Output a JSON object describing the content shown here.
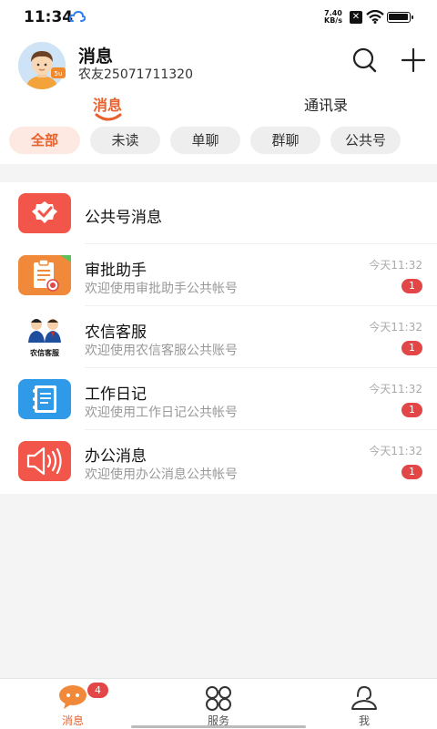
{
  "status_bar": {
    "time": "11:34",
    "net_speed_value": "7.40",
    "net_speed_unit": "KB/s"
  },
  "header": {
    "title": "消息",
    "subtitle": "农友25071711320",
    "avatar_icon": "user-avatar-icon",
    "search_icon": "search-icon",
    "add_icon": "plus-icon"
  },
  "tabs": [
    {
      "label": "消息",
      "active": true
    },
    {
      "label": "通讯录",
      "active": false
    }
  ],
  "filters": [
    {
      "label": "全部",
      "active": true
    },
    {
      "label": "未读",
      "active": false
    },
    {
      "label": "单聊",
      "active": false
    },
    {
      "label": "群聊",
      "active": false
    },
    {
      "label": "公共号",
      "active": false
    }
  ],
  "list": [
    {
      "name": "公共号消息",
      "subtitle": "",
      "time": "",
      "badge": "",
      "icon": "official-account-icon",
      "color": "#f2564a"
    },
    {
      "name": "审批助手",
      "subtitle": "欢迎使用审批助手公共帐号",
      "time": "今天11:32",
      "badge": "1",
      "icon": "approval-clipboard-icon",
      "color": "#f08a3a"
    },
    {
      "name": "农信客服",
      "subtitle": "欢迎使用农信客服公共账号",
      "time": "今天11:32",
      "badge": "1",
      "icon": "customer-service-icon",
      "icon_label": "农信客服",
      "color": "#ffffff"
    },
    {
      "name": "工作日记",
      "subtitle": "欢迎使用工作日记公共帐号",
      "time": "今天11:32",
      "badge": "1",
      "icon": "notebook-icon",
      "color": "#2f9ae8"
    },
    {
      "name": "办公消息",
      "subtitle": "欢迎使用办公消息公共帐号",
      "time": "今天11:32",
      "badge": "1",
      "icon": "speaker-icon",
      "color": "#f2564a"
    }
  ],
  "bottom_nav": [
    {
      "label": "消息",
      "active": true,
      "badge": "4",
      "icon": "chat-bubble-icon"
    },
    {
      "label": "服务",
      "active": false,
      "badge": "",
      "icon": "services-grid-icon"
    },
    {
      "label": "我",
      "active": false,
      "badge": "",
      "icon": "profile-icon"
    }
  ],
  "colors": {
    "accent": "#e8602c",
    "badge": "#e24646"
  }
}
